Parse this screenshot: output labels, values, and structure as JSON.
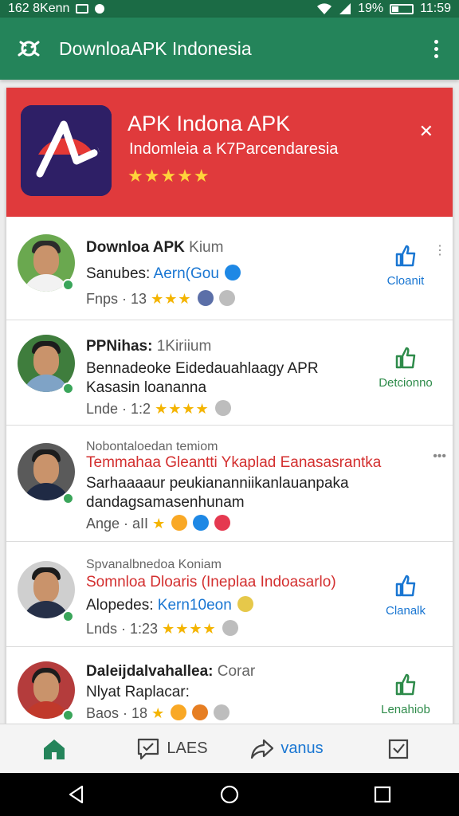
{
  "status_bar": {
    "left_text": "162 8Kenn",
    "battery": "19%",
    "time": "11:59"
  },
  "app_bar": {
    "title": "DownloaAPK Indonesia"
  },
  "banner": {
    "title": "APK Indona APK",
    "subtitle": "Indomleia a K7Parcendaresia",
    "stars": "★★★★★"
  },
  "rows": [
    {
      "name": "Downloa APK",
      "name_muted": "Kium",
      "line2_label": "Sanubes:",
      "line2_link": "Aern(Gou",
      "meta": "Fnps · 13",
      "stars": "★★★",
      "action": "Cloanit"
    },
    {
      "name": "PPNihas:",
      "name_muted": "1Kiriium",
      "line2": "Bennadeoke Eidedauahlaagy APR",
      "line3": "Kasasin loananna",
      "meta": "Lnde · 1:2",
      "stars": "★★★★",
      "action": "Detcionno"
    },
    {
      "line1": "Nobontaloedan temiom",
      "line2": "Temmahaa Gleantti Ykaplad Eanasasrantka",
      "line3": "Sarhaaaaur peukiananniikanlauanpaka",
      "line4": "dandagsamasenhunam",
      "meta": "Ange · aII",
      "stars": "★"
    },
    {
      "line1": "Spvanalbnedoa Koniam",
      "line2": "Somnloa Dloaris (Ineplaa Indoasarlo)",
      "line3_label": "Alopedes:",
      "line3_link": "Kern10eon",
      "meta": "Lnds · 1:23",
      "stars": "★★★★",
      "action": "Clanalk"
    },
    {
      "name": "Daleijdalvahallea:",
      "name_muted": "Corar",
      "line2": "Nlyat Raplacar:",
      "meta": "Baos · 18",
      "stars": "★",
      "action": "Lenahiob"
    }
  ],
  "bottom_nav": {
    "home": "",
    "likes": "LAES",
    "share": "vanus",
    "check": ""
  },
  "colors": {
    "app_bar": "#24845a",
    "status_bar": "#1b6b45",
    "banner": "#e03a3c",
    "accent_blue": "#1976d2",
    "accent_green": "#2e8b4a",
    "star": "#f4b400"
  }
}
